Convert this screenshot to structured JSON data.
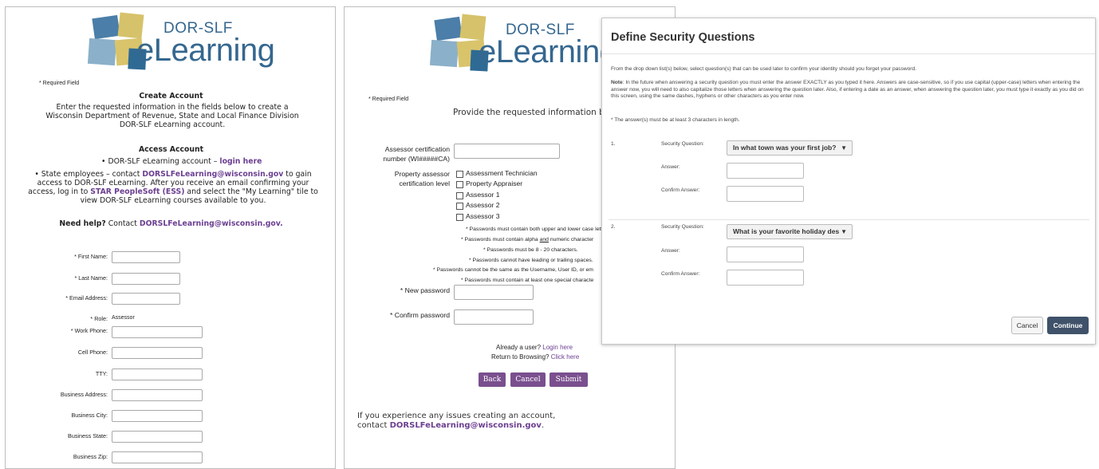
{
  "brand": {
    "line1": "DOR-SLF",
    "line2": "eLearning"
  },
  "create": {
    "required_note": "* Required Field",
    "title": "Create Account",
    "intro": "Enter the requested information in the fields below to create a Wisconsin Department of Revenue, State and Local Finance Division DOR-SLF eLearning account.",
    "access_title": "Access Account",
    "access_bullet_text": "DOR-SLF eLearning account – ",
    "access_bullet_link": "login here",
    "state_text1": "State employees – contact ",
    "state_email": "DORSLFeLearning@wisconsin.gov",
    "state_text2": " to gain access to DOR-SLF eLearning. After you receive an email confirming your access, log in to ",
    "state_link": "STAR PeopleSoft (ESS)",
    "state_text3": " and select the \"My Learning\" tile to view DOR-SLF eLearning courses available to you.",
    "help_label": "Need help?",
    "help_text": " Contact ",
    "help_email": "DORSLFeLearning@wisconsin.gov.",
    "fields": [
      {
        "label": "* First Name:",
        "value": ""
      },
      {
        "label": "* Last Name:",
        "value": ""
      },
      {
        "label": "* Email Address:",
        "value": ""
      }
    ],
    "role_label": "* Role:",
    "role_value": "Assessor",
    "fields2": [
      {
        "label": "* Work Phone:",
        "value": ""
      },
      {
        "label": "Cell Phone:",
        "value": ""
      },
      {
        "label": "TTY:",
        "value": ""
      },
      {
        "label": "Business Address:",
        "value": ""
      },
      {
        "label": "Business City:",
        "value": ""
      },
      {
        "label": "Business State:",
        "value": ""
      },
      {
        "label": "Business Zip:",
        "value": ""
      }
    ]
  },
  "provide": {
    "required_note": "* Required Field",
    "intro": "Provide the requested information bel",
    "cert_label1": "Assessor certification",
    "cert_label2": "number (WI#####CA)",
    "level_label1": "Property assessor",
    "level_label2": "certification level",
    "levels": [
      "Assessment Technician",
      "Property Appraiser",
      "Assessor 1",
      "Assessor 2",
      "Assessor 3"
    ],
    "rules": [
      "* Passwords must contain both upper and lower case lett",
      "* Passwords must contain alpha ",
      "and",
      " numeric character",
      "* Passwords must be 8 - 20 characters.",
      "* Passwords cannot have leading or trailing spaces.",
      "* Passwords cannot be the same as the Username, User ID, or em",
      "* Passwords must contain at least one special characte"
    ],
    "new_password_label": "* New password",
    "confirm_password_label": "* Confirm password",
    "already_text": "Already a user?",
    "login_link": "Login here",
    "return_text": "Return to Browsing?",
    "click_link": "Click here",
    "buttons": {
      "back": "Back",
      "cancel": "Cancel",
      "submit": "Submit"
    },
    "issues_text": "If you experience any issues creating an account,",
    "issues_contact": "contact ",
    "issues_email": "DORSLFeLearning@wisconsin.gov",
    "issues_period": "."
  },
  "dialog": {
    "title": "Define Security Questions",
    "intro": "From the drop down list(s) below, select question(s) that can be used later to confirm your identity should you forget your password.",
    "note_label": "Note",
    "note_text": ": In the future when answering a security question you must enter the answer EXACTLY as you typed it here. Answers are case-sensitive, so if you use capital (upper-case) letters when entering the answer now, you will need to also capitalize those letters when answering the question later. Also, if entering a date as an answer, when answering the question later, you must type it exactly as you did on this screen, using the same dashes, hyphens or other characters as you enter now.",
    "length_note": "* The answer(s) must be at least 3 characters in length.",
    "questions": [
      {
        "num": "1.",
        "q_label": "Security Question:",
        "selected": "In what town was your first job?",
        "answer_label": "Answer:",
        "confirm_label": "Confirm Answer:"
      },
      {
        "num": "2.",
        "q_label": "Security Question:",
        "selected": "What is your favorite holiday des",
        "answer_label": "Answer:",
        "confirm_label": "Confirm Answer:"
      }
    ],
    "cancel": "Cancel",
    "continue": "Continue"
  }
}
